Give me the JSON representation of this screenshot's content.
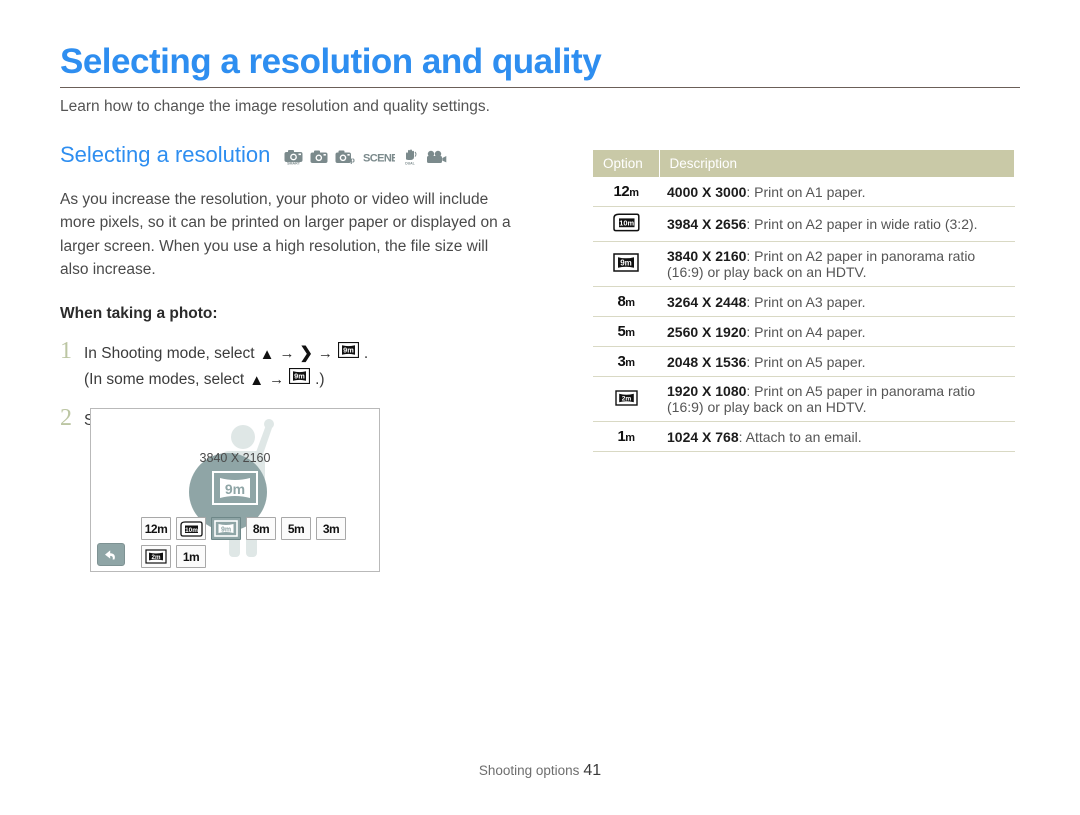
{
  "page": {
    "title": "Selecting a resolution and quality",
    "subtitle": "Learn how to change the image resolution and quality settings.",
    "accent_color": "#2e8ef0",
    "rule_color": "#6b5f58"
  },
  "section": {
    "title": "Selecting a resolution",
    "mode_icons": [
      "smart-camera-icon",
      "camera-icon",
      "camera-program-icon",
      "scene-icon",
      "dual-is-icon",
      "movie-camera-icon"
    ],
    "body": "As you increase the resolution, your photo or video will include more pixels, so it can be printed on larger paper or displayed on a larger screen. When you use a high resolution, the file size will also increase.",
    "sub_head": "When taking a photo:"
  },
  "steps": [
    {
      "num": "1",
      "line1_pre": "In Shooting mode, select",
      "line1_post": ".",
      "line2_pre": "(In some modes, select",
      "line2_post": ".)"
    },
    {
      "num": "2",
      "text": "Select an option."
    }
  ],
  "screen": {
    "resolution_label": "3840 X 2160",
    "selected_option": "9m",
    "back_button": "back-arrow-icon",
    "buttons_row1": [
      "12m",
      "10m",
      "9m",
      "8m",
      "5m",
      "3m"
    ],
    "buttons_row2": [
      "2m",
      "1m"
    ]
  },
  "table": {
    "headers": [
      "Option",
      "Description"
    ],
    "rows": [
      {
        "option": "12m",
        "option_style": "plain",
        "dimensions": "4000 X 3000",
        "description": ": Print on A1 paper.",
        "description_line2": ""
      },
      {
        "option": "10m",
        "option_style": "wide",
        "dimensions": "3984 X 2656",
        "description": ": Print on A2 paper in wide ratio (3:2).",
        "description_line2": ""
      },
      {
        "option": "9m",
        "option_style": "pano",
        "dimensions": "3840 X 2160",
        "description": ": Print on A2 paper in panorama ratio",
        "description_line2": "(16:9) or play back on an HDTV."
      },
      {
        "option": "8m",
        "option_style": "plain",
        "dimensions": "3264 X 2448",
        "description": ": Print on A3 paper.",
        "description_line2": ""
      },
      {
        "option": "5m",
        "option_style": "plain",
        "dimensions": "2560 X 1920",
        "description": ": Print on A4 paper.",
        "description_line2": ""
      },
      {
        "option": "3m",
        "option_style": "plain",
        "dimensions": "2048 X 1536",
        "description": ": Print on A5 paper.",
        "description_line2": ""
      },
      {
        "option": "2m",
        "option_style": "pano",
        "dimensions": "1920 X 1080",
        "description": ": Print on A5 paper in panorama ratio",
        "description_line2": "(16:9) or play back on an HDTV."
      },
      {
        "option": "1m",
        "option_style": "plain",
        "dimensions": "1024 X 768",
        "description": ": Attach to an email.",
        "description_line2": ""
      }
    ],
    "header_bg": "#c9c9a7"
  },
  "footer": {
    "label": "Shooting options",
    "page_number": "41"
  }
}
